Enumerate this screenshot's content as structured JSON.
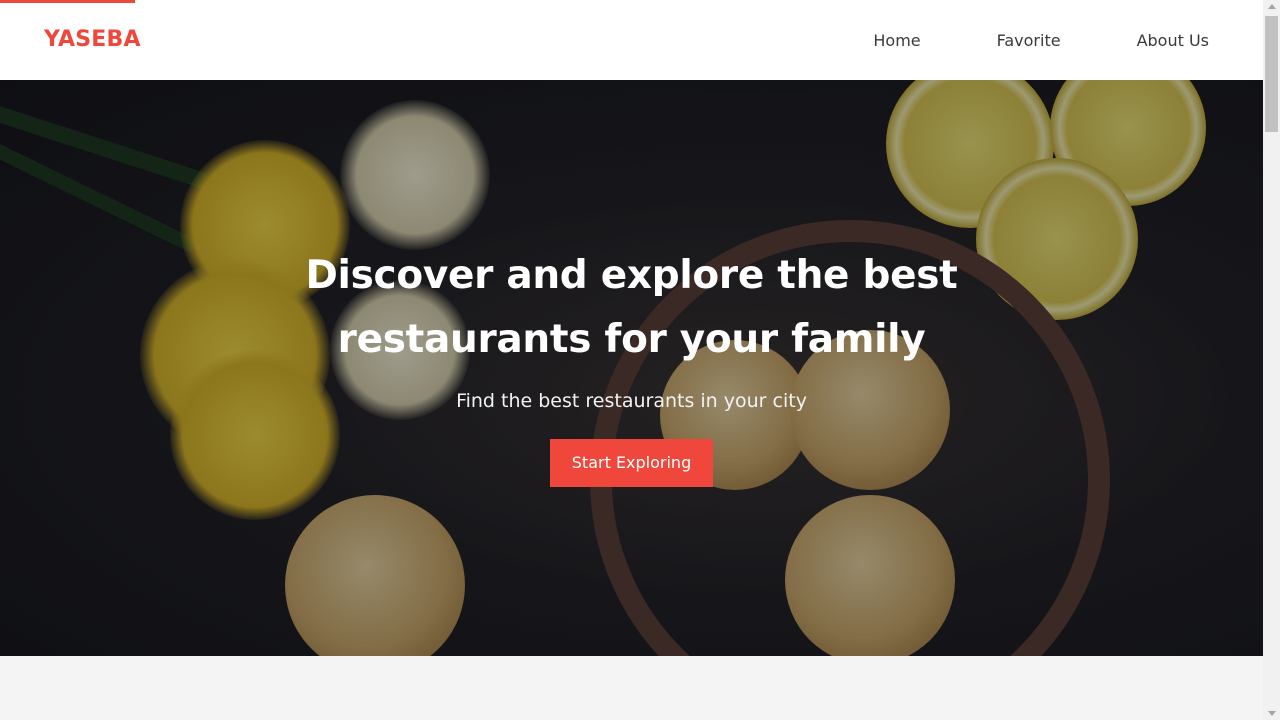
{
  "brand": {
    "name": "YASEBA",
    "accent_color": "#f0473c"
  },
  "nav": {
    "items": [
      {
        "label": "Home"
      },
      {
        "label": "Favorite"
      },
      {
        "label": "About Us"
      }
    ]
  },
  "hero": {
    "title_line1": "Discover and explore the best",
    "title_line2": "restaurants for your family",
    "subtitle": "Find the best restaurants in your city",
    "cta_label": "Start Exploring",
    "background_image": "food-photo"
  }
}
